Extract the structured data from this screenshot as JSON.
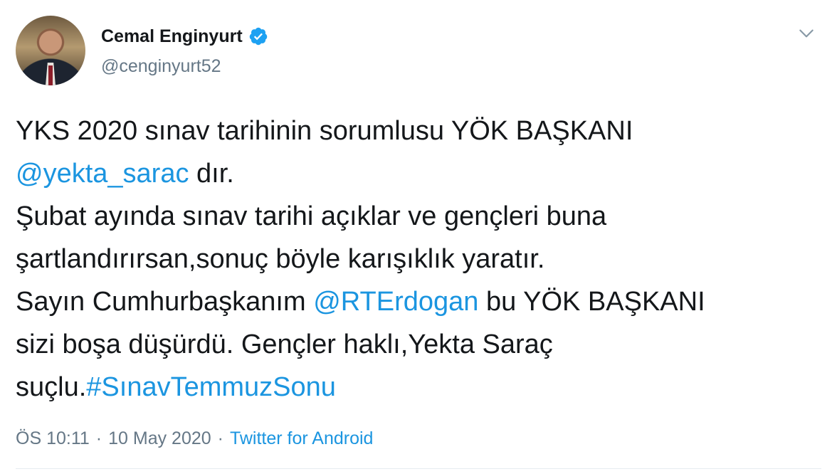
{
  "user": {
    "display_name": "Cemal Enginyurt",
    "handle": "@cenginyurt52",
    "verified": true,
    "verified_color": "#1da1f2",
    "avatar_icon": "avatar-photo"
  },
  "tweet": {
    "lines": [
      [
        {
          "text": "YKS 2020 sınav tarihinin sorumlusu YÖK BAŞKANI",
          "type": "text"
        }
      ],
      [
        {
          "text": "@yekta_sarac",
          "type": "mention"
        },
        {
          "text": " dır.",
          "type": "text"
        }
      ],
      [
        {
          "text": "Şubat ayında sınav tarihi açıklar ve gençleri buna",
          "type": "text"
        }
      ],
      [
        {
          "text": "şartlandırırsan,sonuç böyle karışıklık yaratır.",
          "type": "text"
        }
      ],
      [
        {
          "text": "Sayın Cumhurbaşkanım ",
          "type": "text"
        },
        {
          "text": "@RTErdogan",
          "type": "mention"
        },
        {
          "text": " bu YÖK BAŞKANI",
          "type": "text"
        }
      ],
      [
        {
          "text": "sizi boşa düşürdü. Gençler haklı,Yekta Saraç",
          "type": "text"
        }
      ],
      [
        {
          "text": "suçlu.",
          "type": "text"
        },
        {
          "text": "#SınavTemmuzSonu",
          "type": "hashtag"
        }
      ]
    ],
    "link_color": "#1b95e0"
  },
  "meta": {
    "time": "ÖS 10:11",
    "separator": "·",
    "date": "10 May 2020",
    "source": "Twitter for Android"
  },
  "icons": {
    "menu": "chevron-down-icon",
    "verified": "verified-badge-icon"
  }
}
